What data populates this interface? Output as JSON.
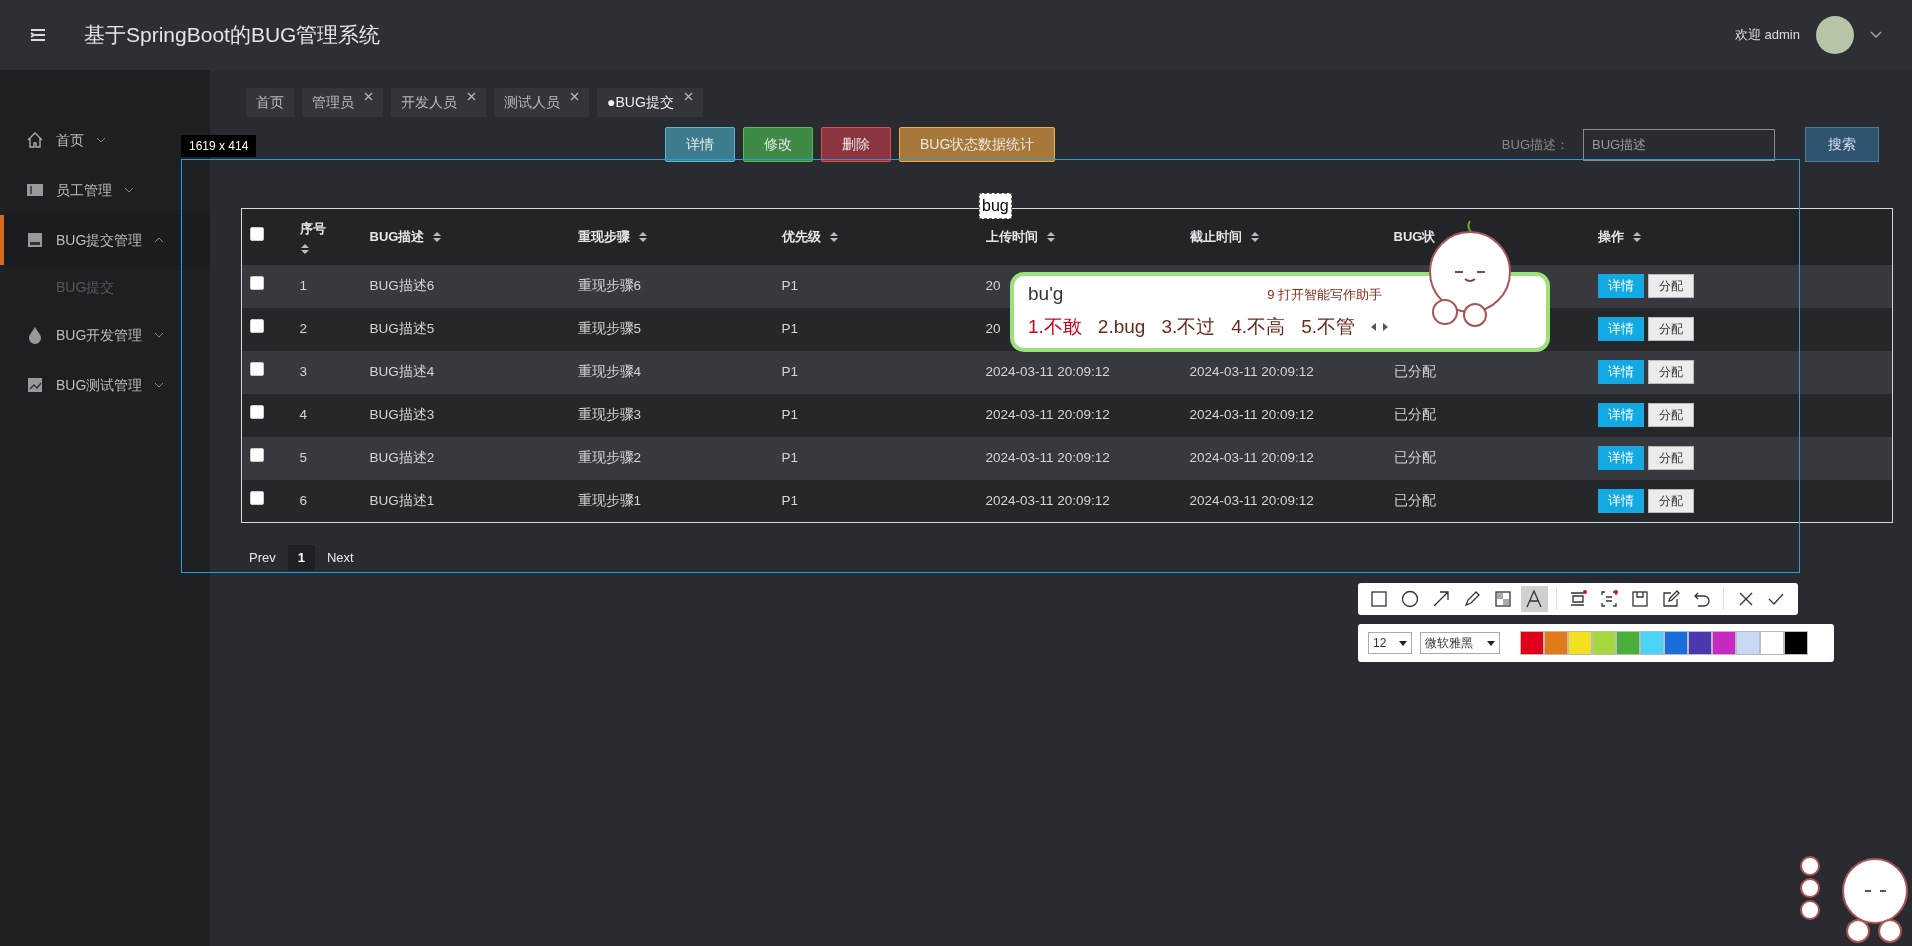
{
  "header": {
    "title": "基于SpringBoot的BUG管理系统",
    "welcome": "欢迎 admin"
  },
  "sidebar": {
    "items": [
      {
        "label": "首页",
        "expanded": false,
        "selected": false
      },
      {
        "label": "员工管理",
        "expanded": false,
        "selected": false
      },
      {
        "label": "BUG提交管理",
        "expanded": true,
        "selected": true,
        "children": [
          {
            "label": "BUG提交",
            "selected": false
          }
        ]
      },
      {
        "label": "BUG开发管理",
        "expanded": false,
        "selected": false
      },
      {
        "label": "BUG测试管理",
        "expanded": false,
        "selected": false
      }
    ]
  },
  "tabs": [
    {
      "label": "首页",
      "closable": false,
      "selected": false
    },
    {
      "label": "管理员",
      "closable": true,
      "selected": false
    },
    {
      "label": "开发人员",
      "closable": true,
      "selected": false
    },
    {
      "label": "测试人员",
      "closable": true,
      "selected": false
    },
    {
      "label": "●BUG提交",
      "closable": true,
      "selected": true
    }
  ],
  "actions": [
    {
      "label": "详情",
      "kind": "info"
    },
    {
      "label": "修改",
      "kind": "success"
    },
    {
      "label": "删除",
      "kind": "danger"
    },
    {
      "label": "BUG状态数据统计",
      "kind": "warning"
    }
  ],
  "search": {
    "label": "BUG描述：",
    "placeholder": "BUG描述",
    "button": "搜索"
  },
  "table": {
    "columns": [
      {
        "label": "序号",
        "sortable": true
      },
      {
        "label": "BUG描述",
        "sortable": true
      },
      {
        "label": "重现步骤",
        "sortable": true
      },
      {
        "label": "优先级",
        "sortable": true
      },
      {
        "label": "上传时间",
        "sortable": true
      },
      {
        "label": "截止时间",
        "sortable": true
      },
      {
        "label": "BUG状",
        "sortable": false
      },
      {
        "label": "操作",
        "sortable": true
      }
    ],
    "header_checked": false,
    "rows": [
      {
        "checked": false,
        "cells": [
          "1",
          "BUG描述6",
          "重现步骤6",
          "P1",
          "20",
          "",
          ""
        ],
        "actions": [
          "详情",
          "分配"
        ]
      },
      {
        "checked": false,
        "cells": [
          "2",
          "BUG描述5",
          "重现步骤5",
          "P1",
          "20",
          "",
          ""
        ],
        "actions": [
          "详情",
          "分配"
        ]
      },
      {
        "checked": false,
        "cells": [
          "3",
          "BUG描述4",
          "重现步骤4",
          "P1",
          "2024-03-11 20:09:12",
          "2024-03-11 20:09:12",
          "已分配"
        ],
        "actions": [
          "详情",
          "分配"
        ]
      },
      {
        "checked": false,
        "cells": [
          "4",
          "BUG描述3",
          "重现步骤3",
          "P1",
          "2024-03-11 20:09:12",
          "2024-03-11 20:09:12",
          "已分配"
        ],
        "actions": [
          "详情",
          "分配"
        ]
      },
      {
        "checked": false,
        "cells": [
          "5",
          "BUG描述2",
          "重现步骤2",
          "P1",
          "2024-03-11 20:09:12",
          "2024-03-11 20:09:12",
          "已分配"
        ],
        "actions": [
          "详情",
          "分配"
        ]
      },
      {
        "checked": false,
        "cells": [
          "6",
          "BUG描述1",
          "重现步骤1",
          "P1",
          "2024-03-11 20:09:12",
          "2024-03-11 20:09:12",
          "已分配"
        ],
        "actions": [
          "详情",
          "分配"
        ]
      }
    ]
  },
  "pagination": {
    "prev": "Prev",
    "pages": [
      {
        "label": "1",
        "selected": true
      }
    ],
    "next": "Next"
  },
  "screenshot_tool": {
    "size_label": "1619 x 414",
    "text_input": "bug",
    "tools": [
      {
        "kind": "rect",
        "selected": false
      },
      {
        "kind": "circle",
        "selected": false
      },
      {
        "kind": "arrow",
        "selected": false
      },
      {
        "kind": "pencil",
        "selected": false
      },
      {
        "kind": "mosaic",
        "selected": false
      },
      {
        "kind": "text",
        "selected": true
      },
      {
        "kind": "pin",
        "selected": false
      },
      {
        "kind": "ocr",
        "selected": false
      },
      {
        "kind": "save",
        "selected": false
      },
      {
        "kind": "edit",
        "selected": false
      },
      {
        "kind": "undo",
        "selected": false
      },
      {
        "kind": "close",
        "selected": false
      },
      {
        "kind": "confirm",
        "selected": false
      }
    ],
    "font_size": "12",
    "font": "微软雅黑",
    "colors": [
      {
        "color": "#e0001a"
      },
      {
        "color": "#e07a1a"
      },
      {
        "color": "#f5e020"
      },
      {
        "color": "#a8d840"
      },
      {
        "color": "#4aae3a"
      },
      {
        "color": "#4ad4f5"
      },
      {
        "color": "#1a6edc"
      },
      {
        "color": "#4a38b0"
      },
      {
        "color": "#c828c0"
      },
      {
        "color": "#c8d8f5"
      },
      {
        "color": "#ffffff"
      },
      {
        "color": "#000000"
      }
    ]
  },
  "ime": {
    "composition": "bu'g",
    "assistant": "9 打开智能写作助手",
    "candidates": [
      {
        "label": "1.不敢",
        "selected": true
      },
      {
        "label": "2.bug",
        "selected": false
      },
      {
        "label": "3.不过",
        "selected": false
      },
      {
        "label": "4.不高",
        "selected": false
      },
      {
        "label": "5.不管",
        "selected": false
      }
    ]
  }
}
